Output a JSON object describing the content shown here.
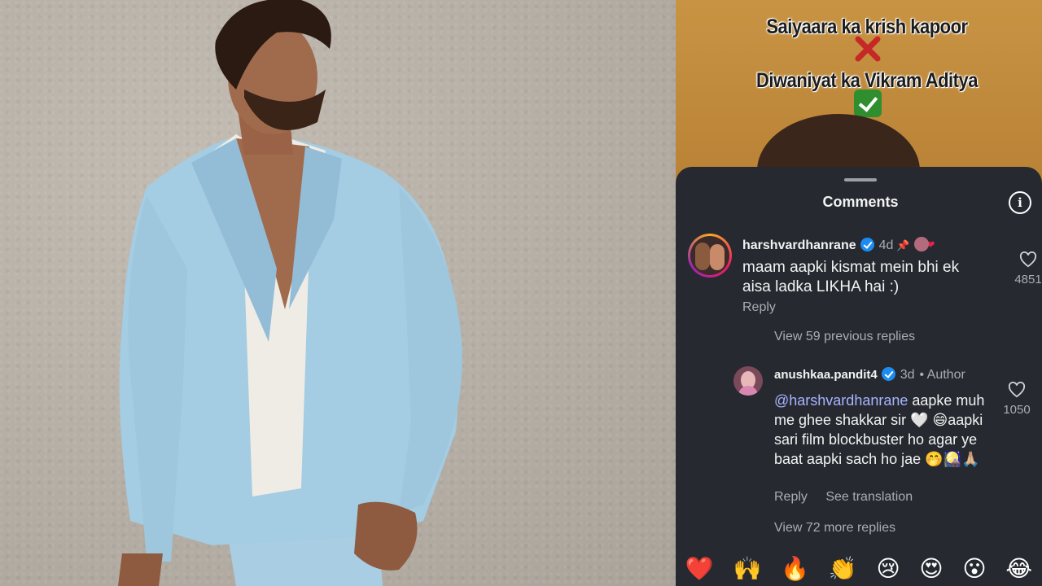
{
  "reel": {
    "caption_line1": "Saiyaara ka krish kapoor",
    "caption_line2": "Diwaniyat ka Vikram Aditya"
  },
  "comments_sheet": {
    "title": "Comments"
  },
  "comments": [
    {
      "username": "harshvardhanrane",
      "time": "4d",
      "text": "maam aapki kismat mein bhi ek aisa ladka LIKHA hai :)",
      "reply_label": "Reply",
      "likes": "4851"
    },
    {
      "username": "anushkaa.pandit4",
      "time": "3d",
      "author_tag": "• Author",
      "mention": "@harshvardhanrane",
      "text": " aapke muh me ghee shakkar sir 🤍 😄aapki sari film blockbuster ho agar ye baat aapki sach ho jae 🤭🎑🙏🏼",
      "reply_label": "Reply",
      "translation_label": "See translation",
      "likes": "1050"
    }
  ],
  "view_previous_replies": "View 59 previous replies",
  "view_more_replies": "View 72 more replies",
  "emoji_bar": [
    "❤️",
    "🙌",
    "🔥",
    "👏",
    "😢",
    "😍",
    "😮",
    "😂"
  ]
}
